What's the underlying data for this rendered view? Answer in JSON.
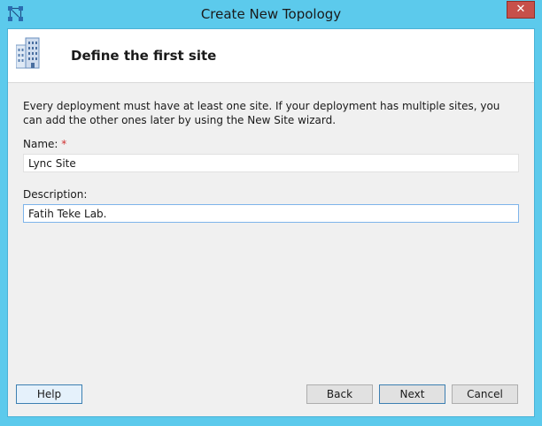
{
  "window": {
    "title": "Create New Topology",
    "close_label": "✕"
  },
  "header": {
    "title": "Define the first site",
    "icon": "building-icon"
  },
  "intro": {
    "text": "Every deployment must have at least one site. If your deployment has multiple sites, you can add the other ones later by using the New Site wizard."
  },
  "form": {
    "name_label": "Name:",
    "name_required_marker": "*",
    "name_value": "Lync Site",
    "description_label": "Description:",
    "description_value": "Fatih Teke Lab."
  },
  "buttons": {
    "help": "Help",
    "back": "Back",
    "next": "Next",
    "cancel": "Cancel"
  },
  "colors": {
    "title_bar": "#5ccaec",
    "close_button": "#c7504a",
    "required_marker": "#d03030"
  }
}
